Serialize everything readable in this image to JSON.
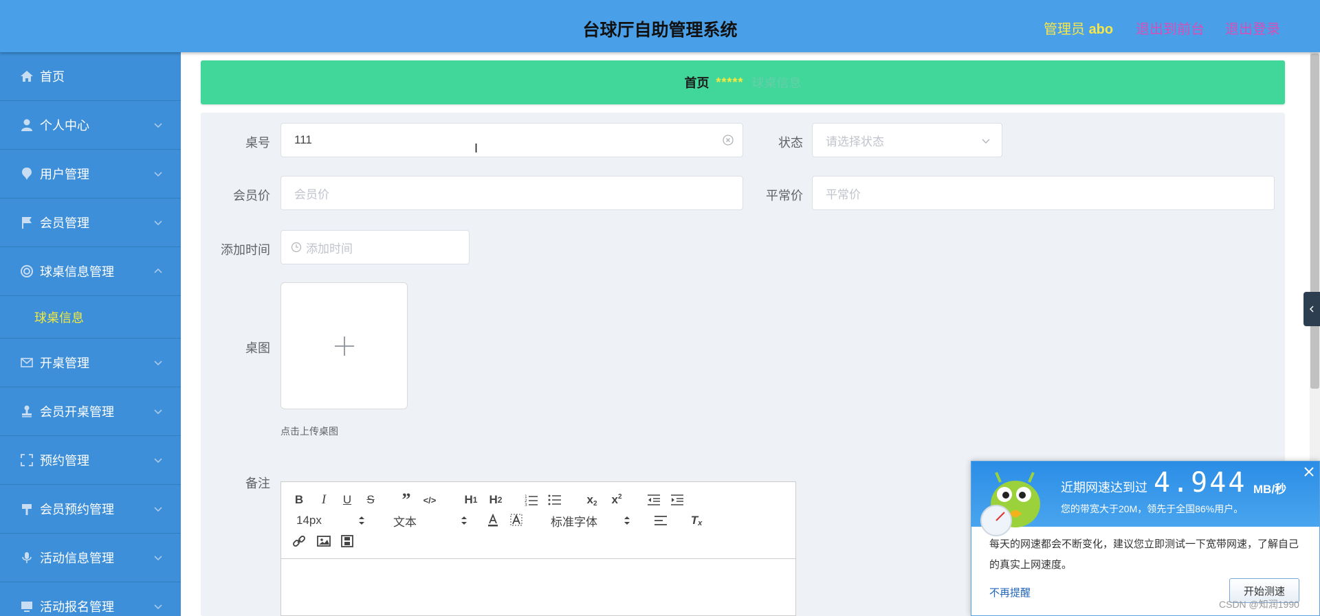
{
  "header": {
    "title": "台球厅自助管理系统",
    "admin_prefix": "管理员",
    "admin_name": "abo",
    "front_link": "退出到前台",
    "logout_link": "退出登录"
  },
  "sidebar": {
    "items": [
      {
        "label": "首页",
        "icon": "home-icon"
      },
      {
        "label": "个人中心",
        "icon": "user-icon"
      },
      {
        "label": "用户管理",
        "icon": "pin-icon"
      },
      {
        "label": "会员管理",
        "icon": "flag-icon"
      },
      {
        "label": "球桌信息管理",
        "icon": "lifebuoy-icon"
      },
      {
        "label": "开桌管理",
        "icon": "mail-icon"
      },
      {
        "label": "会员开桌管理",
        "icon": "stamp-icon"
      },
      {
        "label": "预约管理",
        "icon": "fullscreen-icon"
      },
      {
        "label": "会员预约管理",
        "icon": "signpost-icon"
      },
      {
        "label": "活动信息管理",
        "icon": "microphone-icon"
      },
      {
        "label": "活动报名管理",
        "icon": "monitor-icon"
      }
    ],
    "active_sub": "球桌信息"
  },
  "breadcrumb": {
    "home": "首页",
    "separator": "*****",
    "current": "球桌信息"
  },
  "form": {
    "table_no": {
      "label": "桌号",
      "value": "111"
    },
    "status": {
      "label": "状态",
      "placeholder": "请选择状态"
    },
    "member_price": {
      "label": "会员价",
      "placeholder": "会员价"
    },
    "normal_price": {
      "label": "平常价",
      "placeholder": "平常价"
    },
    "add_time": {
      "label": "添加时间",
      "placeholder": "添加时间"
    },
    "image": {
      "label": "桌图",
      "tip": "点击上传桌图"
    },
    "remark": {
      "label": "备注"
    }
  },
  "editor": {
    "font_size": "14px",
    "text_style": "文本",
    "font_family": "标准字体"
  },
  "popup": {
    "headline": "近期网速达到过",
    "speed": "4.944",
    "unit": "MB/秒",
    "sub": "您的带宽大于20M，领先于全国86%用户。",
    "body": "每天的网速都会不断变化，建议您立即测试一下宽带网速，了解自己的真实上网速度。",
    "dismiss": "不再提醒",
    "start": "开始测速"
  },
  "watermark": "CSDN @知润1990",
  "colors": {
    "header_bg": "#4aa0e8",
    "sidebar_bg": "#3d8fd9",
    "breadcrumb_bg": "#41d69a",
    "panel_bg": "#eef2f6",
    "accent_yellow": "#f3ea3f",
    "link_magenta": "#d64fb8"
  }
}
